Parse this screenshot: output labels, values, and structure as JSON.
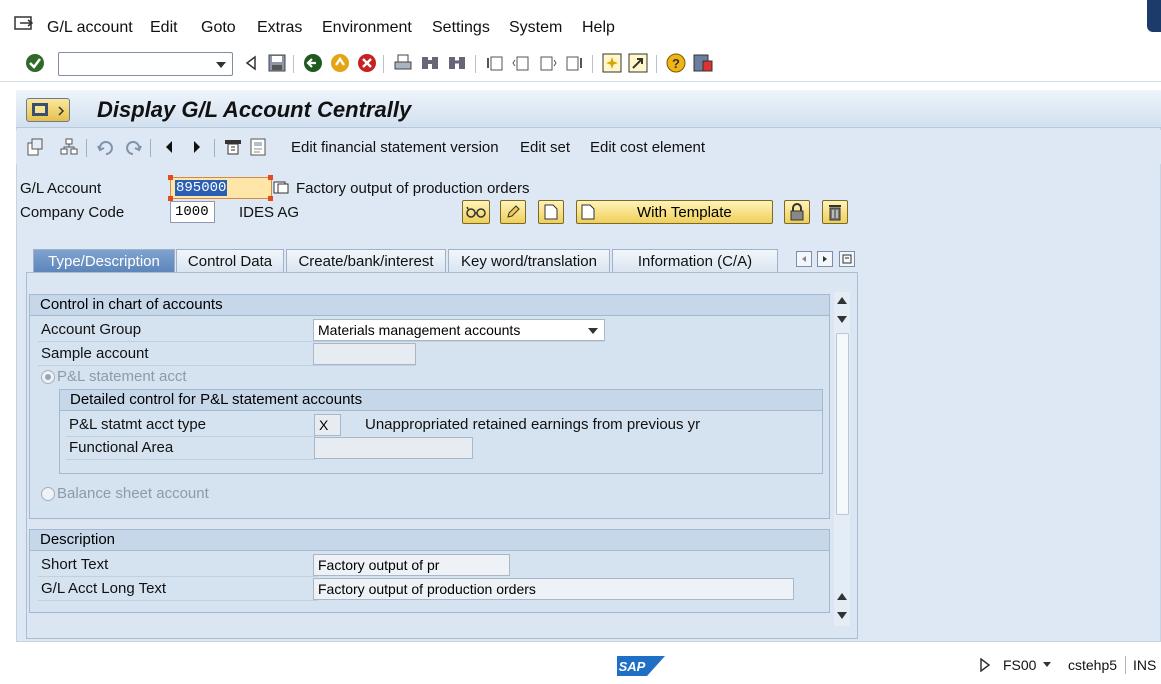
{
  "menubar": {
    "items": [
      "G/L account",
      "Edit",
      "Goto",
      "Extras",
      "Environment",
      "Settings",
      "System",
      "Help"
    ]
  },
  "toolbar": {
    "command_field_value": ""
  },
  "page": {
    "title": "Display G/L Account Centrally"
  },
  "app_toolbar": {
    "edit_fs_version": "Edit financial statement version",
    "edit_set": "Edit set",
    "edit_cost_element": "Edit cost element"
  },
  "header": {
    "gl_account_label": "G/L Account",
    "gl_account_value": "895000",
    "gl_account_desc": "Factory output of production orders",
    "company_code_label": "Company Code",
    "company_code_value": "1000",
    "company_name": "IDES AG",
    "with_template_label": "With Template"
  },
  "tabs": [
    {
      "label": "Type/Description",
      "active": true
    },
    {
      "label": "Control Data",
      "active": false
    },
    {
      "label": "Create/bank/interest",
      "active": false
    },
    {
      "label": "Key word/translation",
      "active": false
    },
    {
      "label": "Information (C/A)",
      "active": false
    }
  ],
  "control_coa": {
    "title": "Control in chart of accounts",
    "account_group_label": "Account Group",
    "account_group_value": "Materials management accounts",
    "sample_account_label": "Sample account",
    "sample_account_value": "",
    "pl_radio_label": "P&L statement acct",
    "detailed": {
      "title": "Detailed control for P&L statement accounts",
      "pl_type_label": "P&L statmt acct type",
      "pl_type_value": "X",
      "pl_type_desc": "Unappropriated retained earnings from previous yr",
      "functional_area_label": "Functional Area",
      "functional_area_value": ""
    },
    "bs_radio_label": "Balance sheet account"
  },
  "description": {
    "title": "Description",
    "short_text_label": "Short Text",
    "short_text_value": "Factory output of pr",
    "long_text_label": "G/L Acct Long Text",
    "long_text_value": "Factory output of production orders"
  },
  "statusbar": {
    "logo": "SAP",
    "transaction": "FS00",
    "server": "cstehp5",
    "mode": "INS"
  },
  "colors": {
    "accent": "#2b5fb3",
    "panel_bg": "#dde8f4",
    "active_tab": "#5b84b9",
    "button_yellow": "#f0cf5a"
  }
}
